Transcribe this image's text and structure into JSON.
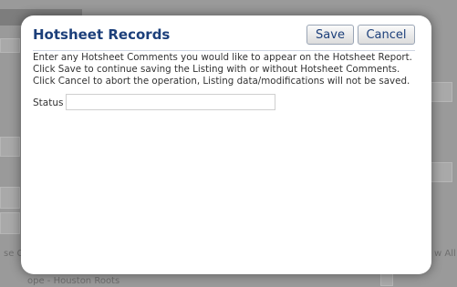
{
  "modal": {
    "title": "Hotsheet Records",
    "save_label": "Save",
    "cancel_label": "Cancel",
    "instructions": [
      "Enter any Hotsheet Comments you would like to appear on the Hotsheet Report.",
      "Click Save to continue saving the Listing with or without Hotsheet Comments.",
      "Click Cancel to abort the operation, Listing data/modifications will not be saved."
    ],
    "status_label": "Status",
    "status_value": ""
  },
  "background": {
    "left_text": "se C",
    "right_text": "w All",
    "bottom_text": "ope - Houston Roots"
  }
}
